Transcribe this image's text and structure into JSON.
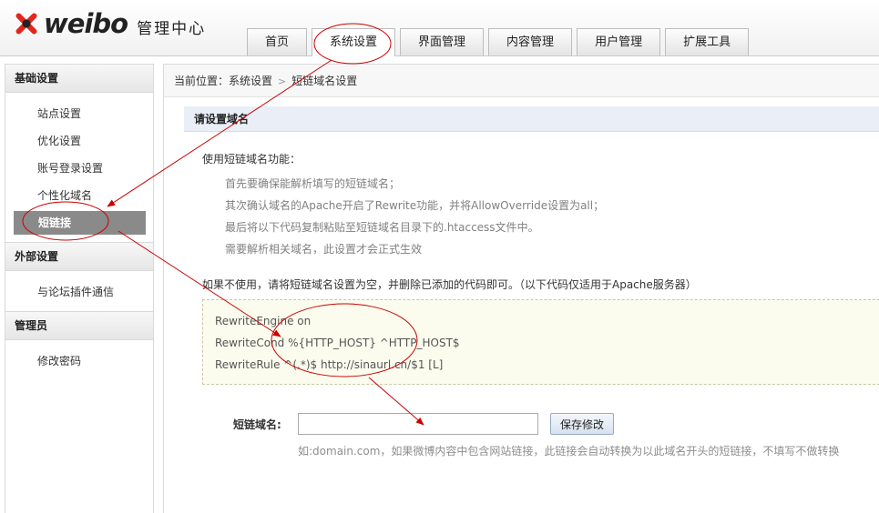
{
  "header": {
    "logo_text": "weibo",
    "logo_subtitle": "管理中心",
    "nav_tabs": [
      {
        "label": "首页",
        "active": false
      },
      {
        "label": "系统设置",
        "active": true
      },
      {
        "label": "界面管理",
        "active": false
      },
      {
        "label": "内容管理",
        "active": false
      },
      {
        "label": "用户管理",
        "active": false
      },
      {
        "label": "扩展工具",
        "active": false
      }
    ]
  },
  "sidebar": {
    "groups": [
      {
        "title": "基础设置",
        "items": [
          {
            "label": "站点设置",
            "active": false
          },
          {
            "label": "优化设置",
            "active": false
          },
          {
            "label": "账号登录设置",
            "active": false
          },
          {
            "label": "个性化域名",
            "active": false
          },
          {
            "label": "短链接",
            "active": true
          }
        ]
      },
      {
        "title": "外部设置",
        "items": [
          {
            "label": "与论坛插件通信",
            "active": false
          }
        ]
      },
      {
        "title": "管理员",
        "items": [
          {
            "label": "修改密码",
            "active": false
          }
        ]
      }
    ]
  },
  "breadcrumb": {
    "prefix": "当前位置：",
    "items": [
      "系统设置",
      "短链域名设置"
    ],
    "separator": ">"
  },
  "main": {
    "section_title": "请设置域名",
    "usage_title": "使用短链域名功能：",
    "steps": [
      "首先要确保能解析填写的短链域名；",
      "其次确认域名的Apache开启了Rewrite功能，并将AllowOverride设置为all；",
      "最后将以下代码复制粘贴至短链域名目录下的.htaccess文件中。",
      "需要解析相关域名，此设置才会正式生效"
    ],
    "note": "如果不使用，请将短链域名设置为空，并删除已添加的代码即可。（以下代码仅适用于Apache服务器）",
    "code_lines": [
      "RewriteEngine on",
      "RewriteCond %{HTTP_HOST} ^HTTP_HOST$",
      "RewriteRule ^(.*)$ http://sinaurl.cn/$1 [L]"
    ],
    "form": {
      "label": "短链域名:",
      "input_value": "",
      "save_label": "保存修改",
      "hint": "如:domain.com，如果微博内容中包含网站链接，此链接会自动转换为以此域名开头的短链接，不填写不做转换"
    }
  },
  "colors": {
    "annotation": "#cc0000",
    "active_sidebar": "#8a8a8a",
    "section_bg": "#e9eef7",
    "code_bg": "#fbfcee"
  }
}
